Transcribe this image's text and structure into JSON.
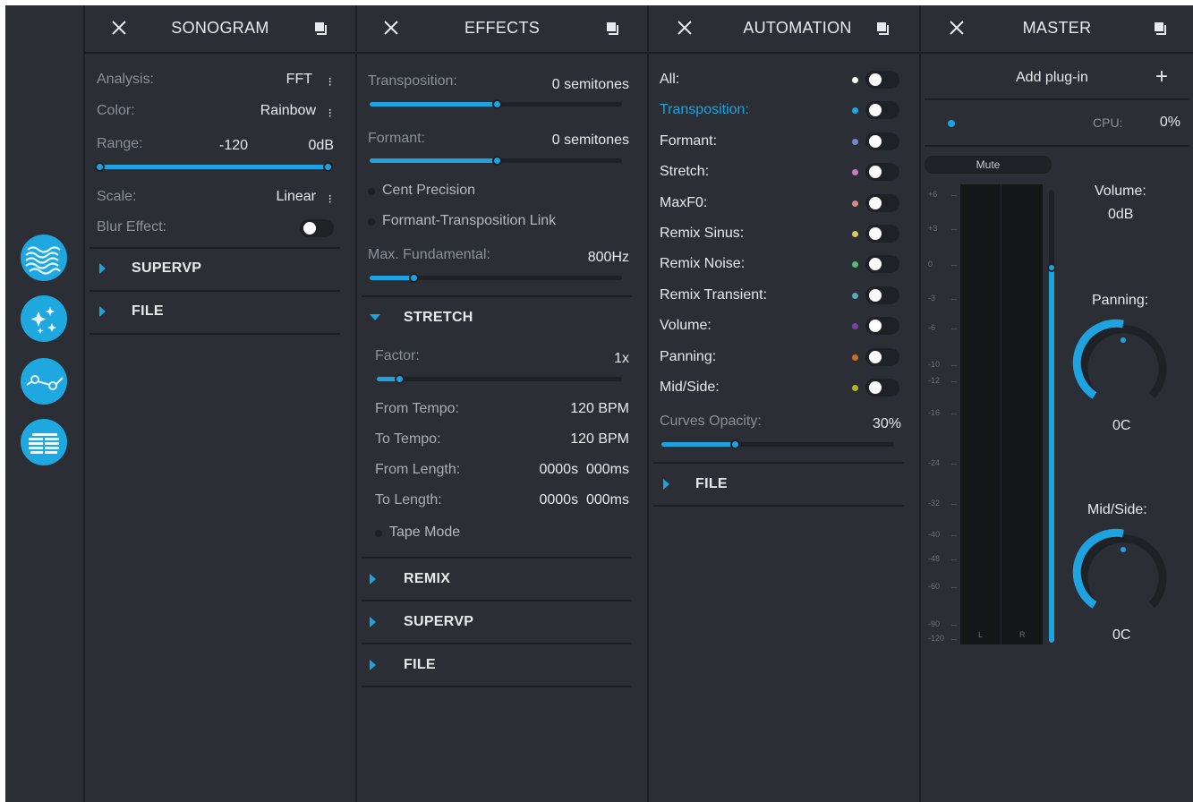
{
  "sidebar": {
    "items": [
      {
        "icon": "sonogram-wave-icon"
      },
      {
        "icon": "effects-sparkle-icon"
      },
      {
        "icon": "automation-curve-icon"
      },
      {
        "icon": "master-meter-icon"
      }
    ],
    "accent": "#1fa8e0"
  },
  "sonogram": {
    "title": "SONOGRAM",
    "analysis_label": "Analysis:",
    "analysis_value": "FFT",
    "color_label": "Color:",
    "color_value": "Rainbow",
    "range_label": "Range:",
    "range_min": "-120",
    "range_max": "0dB",
    "range_fill": 1.0,
    "scale_label": "Scale:",
    "scale_value": "Linear",
    "blur_label": "Blur Effect:",
    "blur_on": false,
    "sections": [
      "SUPERVP",
      "FILE"
    ]
  },
  "effects": {
    "title": "EFFECTS",
    "transposition_label": "Transposition:",
    "transposition_value": "0 semitones",
    "transposition_fill": 0.5,
    "formant_label": "Formant:",
    "formant_value": "0 semitones",
    "formant_fill": 0.5,
    "cent_precision": "Cent Precision",
    "formant_link": "Formant-Transposition Link",
    "max_fund_label": "Max. Fundamental:",
    "max_fund_value": "800Hz",
    "max_fund_fill": 0.18,
    "stretch_section": "STRETCH",
    "factor_label": "Factor:",
    "factor_value": "1x",
    "factor_fill": 0.1,
    "from_tempo_label": "From Tempo:",
    "from_tempo_value": "120 BPM",
    "to_tempo_label": "To Tempo:",
    "to_tempo_value": "120 BPM",
    "from_length_label": "From Length:",
    "from_length_value": "0000s  000ms",
    "to_length_label": "To Length:",
    "to_length_value": "0000s  000ms",
    "tape_mode": "Tape Mode",
    "sections": [
      "REMIX",
      "SUPERVP",
      "FILE"
    ]
  },
  "automation": {
    "title": "AUTOMATION",
    "rows": [
      {
        "label": "All:",
        "color": "#ffffff",
        "active": false
      },
      {
        "label": "Transposition:",
        "color": "#1fa8e0",
        "active": true
      },
      {
        "label": "Formant:",
        "color": "#7b86c9",
        "active": false
      },
      {
        "label": "Stretch:",
        "color": "#c27fb7",
        "active": false
      },
      {
        "label": "MaxF0:",
        "color": "#d48a86",
        "active": false
      },
      {
        "label": "Remix Sinus:",
        "color": "#d9c86a",
        "active": false
      },
      {
        "label": "Remix Noise:",
        "color": "#5dbb78",
        "active": false
      },
      {
        "label": "Remix Transient:",
        "color": "#5aa8b8",
        "active": false
      },
      {
        "label": "Volume:",
        "color": "#7b3fa8",
        "active": false
      },
      {
        "label": "Panning:",
        "color": "#c8702a",
        "active": false
      },
      {
        "label": "Mid/Side:",
        "color": "#b2b22a",
        "active": false
      }
    ],
    "curves_label": "Curves Opacity:",
    "curves_value": "30%",
    "curves_fill": 0.32,
    "sections": [
      "FILE"
    ]
  },
  "master": {
    "title": "MASTER",
    "add_plugin": "Add plug-in",
    "cpu_label": "CPU:",
    "cpu_value": "0%",
    "mute_label": "Mute",
    "meter_ticks": [
      "+6",
      "+3",
      "0",
      "-3",
      "-6",
      "-10",
      "-12",
      "-16",
      "-24",
      "-32",
      "-40",
      "-48",
      "-60",
      "-90",
      "-120"
    ],
    "channel_l": "L",
    "channel_r": "R",
    "volume_label": "Volume:",
    "volume_value": "0dB",
    "volume_fill": 0.83,
    "panning_label": "Panning:",
    "panning_value": "0C",
    "midside_label": "Mid/Side:",
    "midside_value": "0C"
  }
}
